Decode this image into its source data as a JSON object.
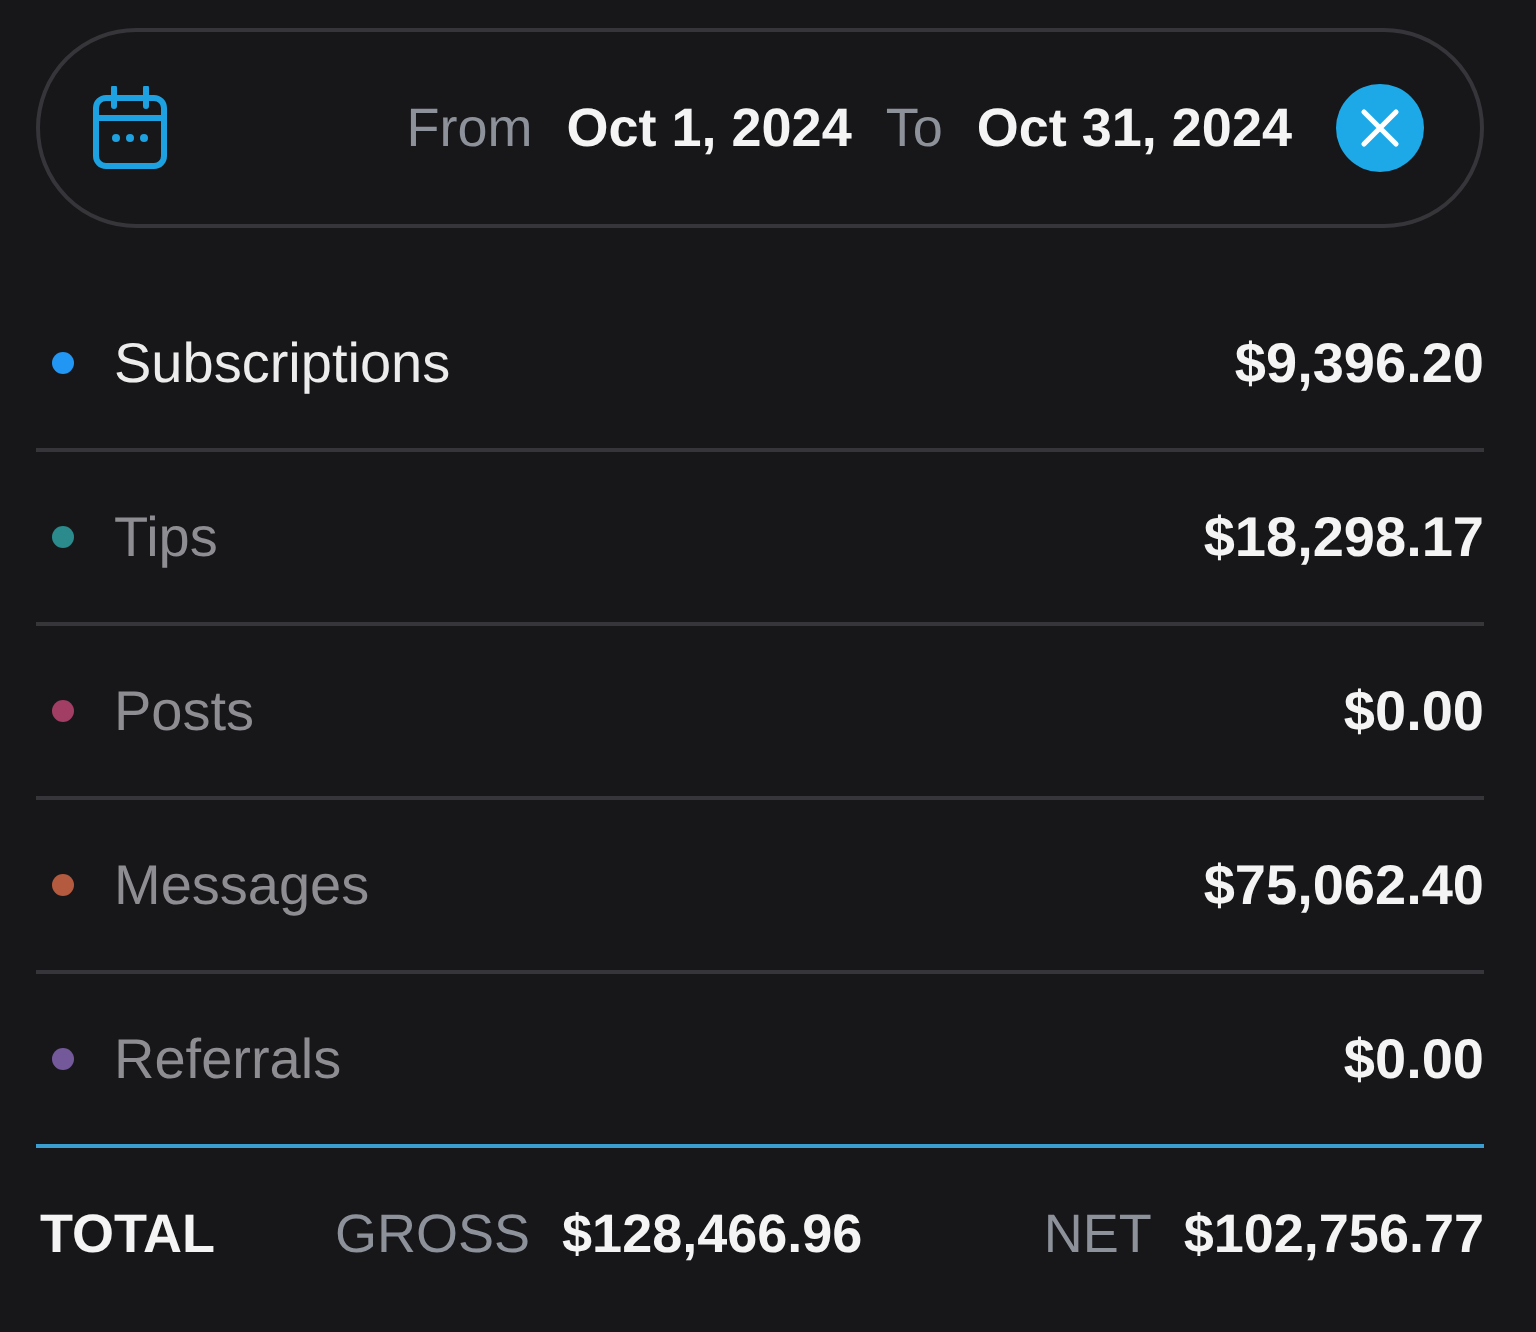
{
  "date_range": {
    "from_label": "From",
    "from_value": "Oct 1, 2024",
    "to_label": "To",
    "to_value": "Oct 31, 2024"
  },
  "categories": [
    {
      "label": "Subscriptions",
      "amount": "$9,396.20",
      "color": "#2196f3",
      "selected": true
    },
    {
      "label": "Tips",
      "amount": "$18,298.17",
      "color": "#2a8a8c",
      "selected": false
    },
    {
      "label": "Posts",
      "amount": "$0.00",
      "color": "#a23d63",
      "selected": false
    },
    {
      "label": "Messages",
      "amount": "$75,062.40",
      "color": "#b45a3e",
      "selected": false
    },
    {
      "label": "Referrals",
      "amount": "$0.00",
      "color": "#73599a",
      "selected": false
    }
  ],
  "total": {
    "label": "TOTAL",
    "gross_label": "GROSS",
    "gross_value": "$128,466.96",
    "net_label": "NET",
    "net_value": "$102,756.77"
  }
}
